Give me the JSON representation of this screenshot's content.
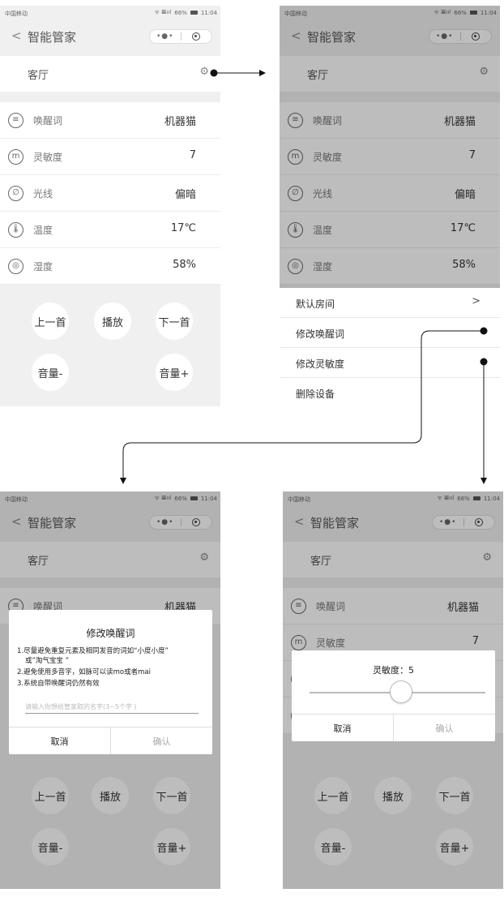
{
  "status": {
    "carrier": "中国移动",
    "signal": "ᯤ 𝌆ııl",
    "battery_pct": "66%",
    "time": "11:04"
  },
  "navbar": {
    "back": "<",
    "title": "智能管家",
    "capsule_dots": "•●•"
  },
  "room": {
    "name": "客厅"
  },
  "rows": [
    {
      "label": "唤醒词",
      "value": "机器猫",
      "icon": "≡"
    },
    {
      "label": "灵敏度",
      "value": "7",
      "icon": "m"
    },
    {
      "label": "光线",
      "value": "偏暗",
      "icon": "∅"
    },
    {
      "label": "温度",
      "value": "17℃",
      "icon": "🌡"
    },
    {
      "label": "湿度",
      "value": "58%",
      "icon": "◎"
    }
  ],
  "controls": {
    "prev": "上一首",
    "play": "播放",
    "next": "下一首",
    "vol_down": "音量-",
    "vol_up": "音量+"
  },
  "sheet": {
    "items": [
      "默认房间",
      "修改唤醒词",
      "修改灵敏度",
      "删除设备"
    ],
    "chevron": ">"
  },
  "wake_dialog": {
    "title": "修改唤醒词",
    "tip1": "1.尽量避免重复元素及相同发音的词如“小度小度”",
    "tip1b": "或”淘气宝宝 ”",
    "tip2": "2.避免使用多音字，如脉可以读mo或者mai",
    "tip3": "3.系统自带唤醒词仍然有效",
    "placeholder": "请输入你想给管家取的名字(3~5个字 )",
    "cancel": "取消",
    "confirm": "确认"
  },
  "sens_dialog": {
    "title": "灵敏度：5",
    "value": 5,
    "cancel": "取消",
    "confirm": "确认"
  }
}
